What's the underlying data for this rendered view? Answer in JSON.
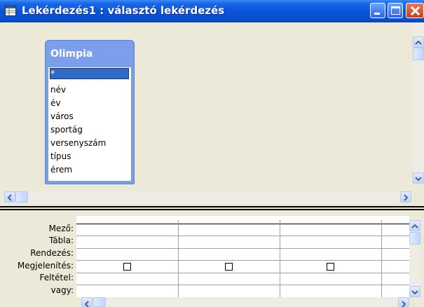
{
  "window": {
    "title": "Lekérdezés1 : választó lekérdezés",
    "title_color": "#0a54d9"
  },
  "table_box": {
    "name": "Olimpia",
    "header_color": "#7c9fec",
    "fields": [
      "*",
      "név",
      "év",
      "város",
      "sportág",
      "versenyszám",
      "típus",
      "érem"
    ],
    "selected_field": "*"
  },
  "grid": {
    "row_labels": [
      "Mező:",
      "Tábla:",
      "Rendezés:",
      "Megjelenítés:",
      "Feltétel:",
      "vagy:"
    ],
    "visible_columns": 3,
    "show_checkboxes": [
      false,
      false,
      false
    ]
  },
  "icons": {
    "app": "query-icon",
    "minimize": "minimize-icon",
    "maximize": "maximize-icon",
    "close": "close-icon"
  }
}
